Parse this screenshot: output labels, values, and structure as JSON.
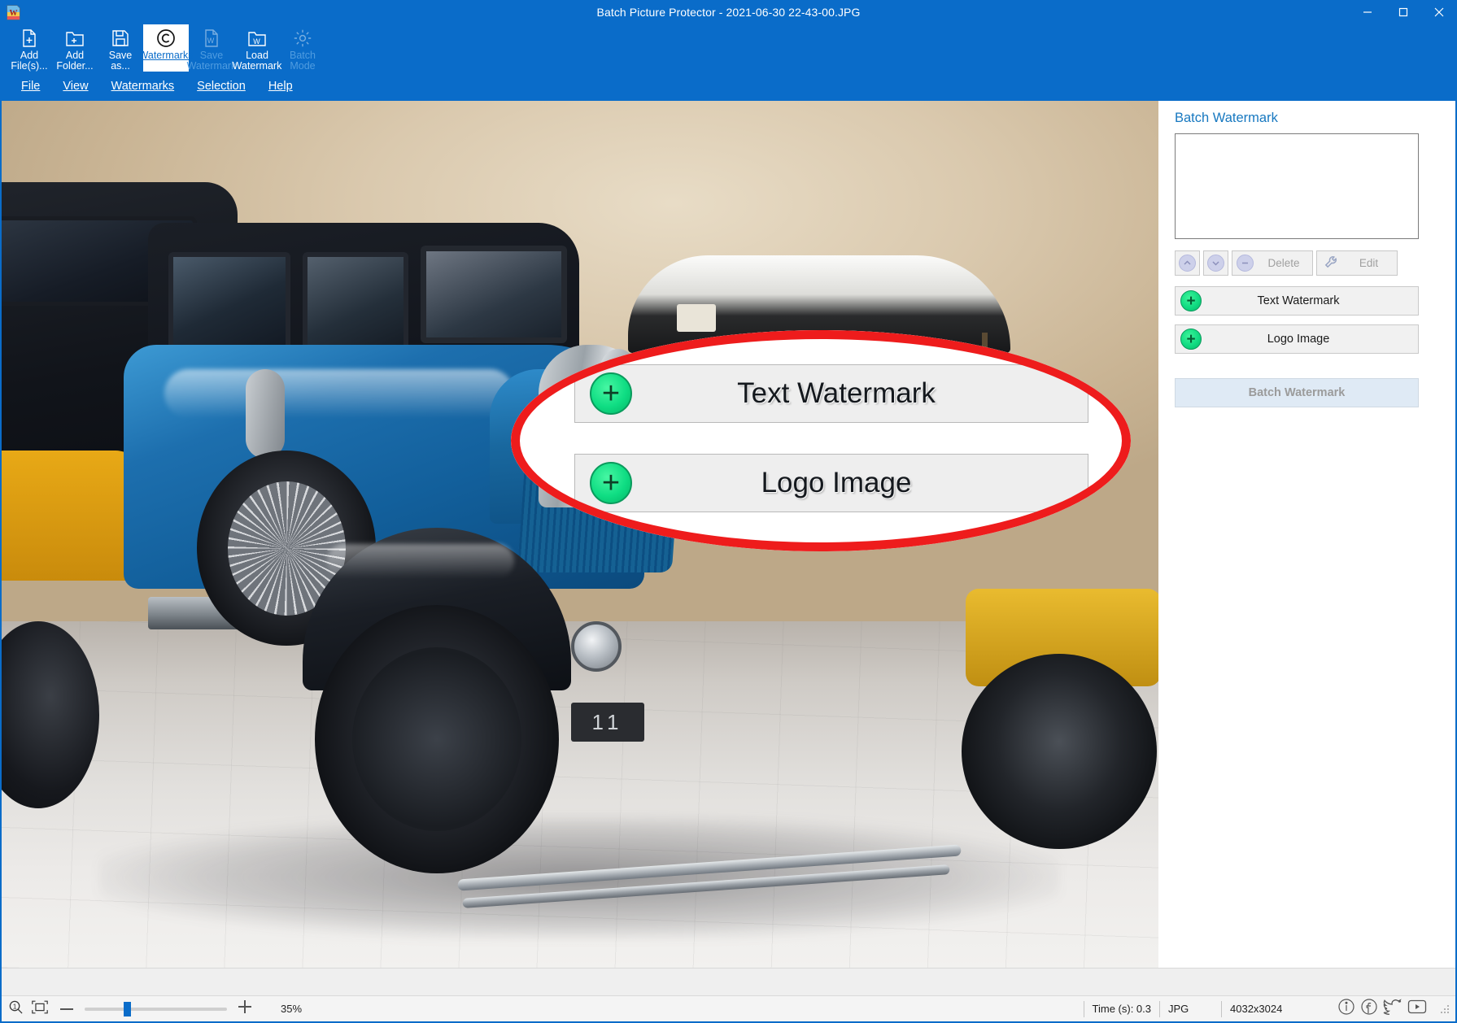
{
  "window": {
    "title": "Batch Picture Protector - 2021-06-30 22-43-00.JPG",
    "app_icon": "watermark-app-icon",
    "minimize": "─",
    "maximize": "□",
    "close": "✕"
  },
  "ribbon": {
    "items": [
      {
        "id": "add-files",
        "label": "Add\nFile(s)...",
        "icon": "file-plus-icon",
        "state": "enabled"
      },
      {
        "id": "add-folder",
        "label": "Add\nFolder...",
        "icon": "folder-plus-icon",
        "state": "enabled"
      },
      {
        "id": "save-as",
        "label": "Save\nas...",
        "icon": "floppy-save-icon",
        "state": "enabled"
      },
      {
        "id": "watermarks",
        "label": "Watermarks",
        "icon": "copyright-icon",
        "state": "active"
      },
      {
        "id": "save-watermark",
        "label": "Save\nWatermark",
        "icon": "w-file-icon",
        "state": "disabled"
      },
      {
        "id": "load-watermark",
        "label": "Load\nWatermark",
        "icon": "w-folder-icon",
        "state": "enabled"
      },
      {
        "id": "batch-mode",
        "label": "Batch\nMode",
        "icon": "gear-icon",
        "state": "disabled"
      }
    ]
  },
  "menubar": {
    "items": [
      {
        "id": "file",
        "label": "File"
      },
      {
        "id": "view",
        "label": "View"
      },
      {
        "id": "watermarks",
        "label": "Watermarks"
      },
      {
        "id": "selection",
        "label": "Selection"
      },
      {
        "id": "help",
        "label": "Help"
      }
    ]
  },
  "panel": {
    "title": "Batch Watermark",
    "list_items": [],
    "toolbar": {
      "move_up": "move-up-button",
      "move_down": "move-down-button",
      "delete_label": "Delete",
      "edit_label": "Edit"
    },
    "text_watermark_label": "Text Watermark",
    "logo_image_label": "Logo Image",
    "batch_watermark_label": "Batch Watermark",
    "plus_glyph": "+"
  },
  "callout": {
    "text_watermark_label": "Text Watermark",
    "logo_image_label": "Logo Image",
    "plus_glyph": "+",
    "ring_color": "#ee1c1c"
  },
  "statusbar": {
    "zoom_icon": "magnifier-1to1-icon",
    "fit_icon": "fit-to-window-icon",
    "minus": "─",
    "plus": "+",
    "zoom_percent": "35%",
    "time_label": "Time (s): 0.3",
    "format": "JPG",
    "dimensions": "4032x3024",
    "social": [
      {
        "id": "info",
        "icon": "info-circle-icon"
      },
      {
        "id": "facebook",
        "icon": "facebook-icon"
      },
      {
        "id": "twitter",
        "icon": "twitter-bird-icon"
      },
      {
        "id": "video",
        "icon": "video-play-icon"
      }
    ]
  },
  "photo": {
    "license_plate": "11"
  },
  "colors": {
    "chrome_blue": "#0a6cc9",
    "accent_link": "#1778c0",
    "green_plus": "#11db82",
    "callout_red": "#ee1c1c",
    "panel_bg": "#ffffff",
    "button_bg": "#f1f1f1"
  }
}
